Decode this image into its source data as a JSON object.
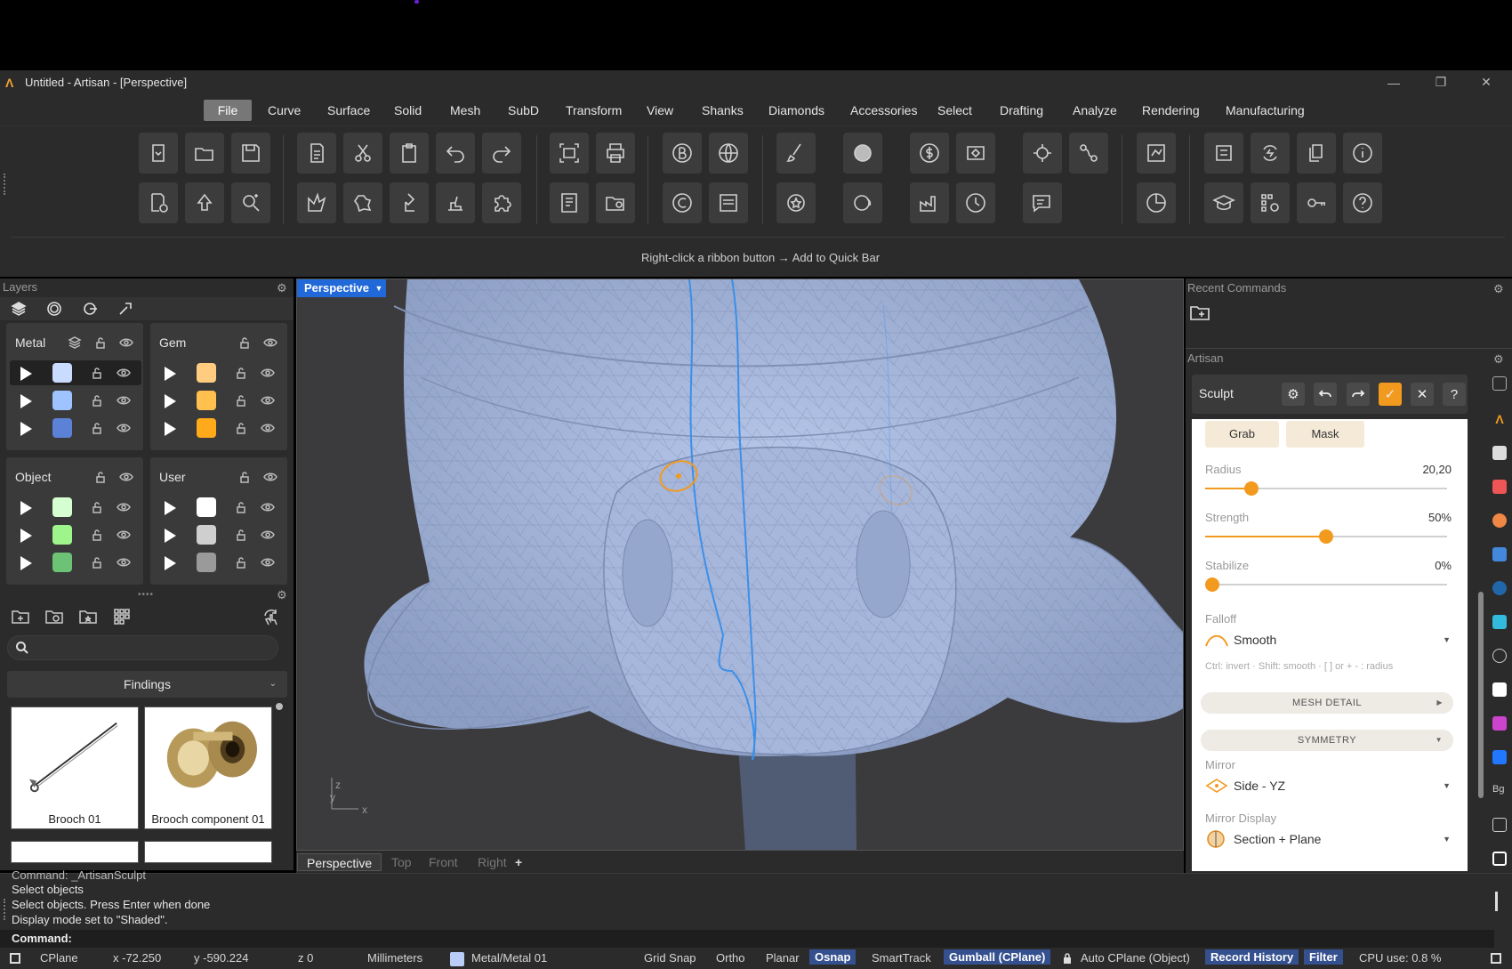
{
  "window": {
    "title": "Untitled - Artisan - [Perspective]",
    "logo": "Λ"
  },
  "menu": [
    "File",
    "Curve",
    "Surface",
    "Solid",
    "Mesh",
    "SubD",
    "Transform",
    "View",
    "Shanks",
    "Diamonds",
    "Accessories",
    "Select",
    "Drafting",
    "Analyze",
    "Rendering",
    "Manufacturing"
  ],
  "menu_active": "File",
  "ribbon": {
    "hint": "Right-click a ribbon button → Add to Quick Bar"
  },
  "layers": {
    "title": "Layers",
    "groups": [
      {
        "name": "Metal",
        "colors": [
          "#c9dcff",
          "#9ec3ff",
          "#5b82d6"
        ]
      },
      {
        "name": "Gem",
        "colors": [
          "#ffcc80",
          "#ffc04d",
          "#ffaa1a"
        ]
      },
      {
        "name": "Object",
        "colors": [
          "#d5ffd0",
          "#9ef58c",
          "#6cc275"
        ]
      },
      {
        "name": "User",
        "colors": [
          "#ffffff",
          "#cfcfcf",
          "#9a9a9a"
        ]
      }
    ]
  },
  "library": {
    "category": "Findings",
    "search_placeholder": "",
    "items": [
      {
        "caption": "Brooch 01"
      },
      {
        "caption": "Brooch component 01"
      }
    ]
  },
  "viewport": {
    "label": "Perspective",
    "axis_z": "z",
    "axis_y": "y",
    "axis_x": "x",
    "tabs": [
      "Perspective",
      "Top",
      "Front",
      "Right"
    ],
    "add_tab": "+",
    "active_tab": "Perspective"
  },
  "recent": {
    "title": "Recent Commands"
  },
  "artisan": {
    "title": "Artisan",
    "tool": "Sculpt",
    "tools": [
      "Grab",
      "Mask"
    ],
    "radius": {
      "label": "Radius",
      "value": "20,20",
      "fraction": 0.19
    },
    "strength": {
      "label": "Strength",
      "value": "50%",
      "fraction": 0.5
    },
    "stabilize": {
      "label": "Stabilize",
      "value": "0%",
      "fraction": 0.0
    },
    "falloff": {
      "label": "Falloff",
      "value": "Smooth"
    },
    "hint": "Ctrl: invert · Shift: smooth · [ ] or + - : radius",
    "mesh_detail": "MESH DETAIL",
    "symmetry": "SYMMETRY",
    "mirror": {
      "label": "Mirror",
      "value": "Side - YZ"
    },
    "mirror_display": {
      "label": "Mirror Display",
      "value": "Section + Plane"
    },
    "accent": "#f29a1e"
  },
  "console": {
    "lines": [
      "Command: _ArtisanSculpt",
      "Select objects",
      "Select objects. Press Enter when done",
      "Display mode set to \"Shaded\"."
    ],
    "prompt": "Command:"
  },
  "status": {
    "cplane": "CPlane",
    "x": "x -72.250",
    "y": "y -590.224",
    "z": "z 0",
    "units": "Millimeters",
    "layer": "Metal/Metal 01",
    "layer_color": "#b9cdf7",
    "toggles": [
      "Grid Snap",
      "Ortho",
      "Planar",
      "Osnap",
      "SmartTrack",
      "Gumball (CPlane)",
      "Auto CPlane (Object)",
      "Record History",
      "Filter"
    ],
    "cpu": "CPU use: 0.8 %"
  }
}
